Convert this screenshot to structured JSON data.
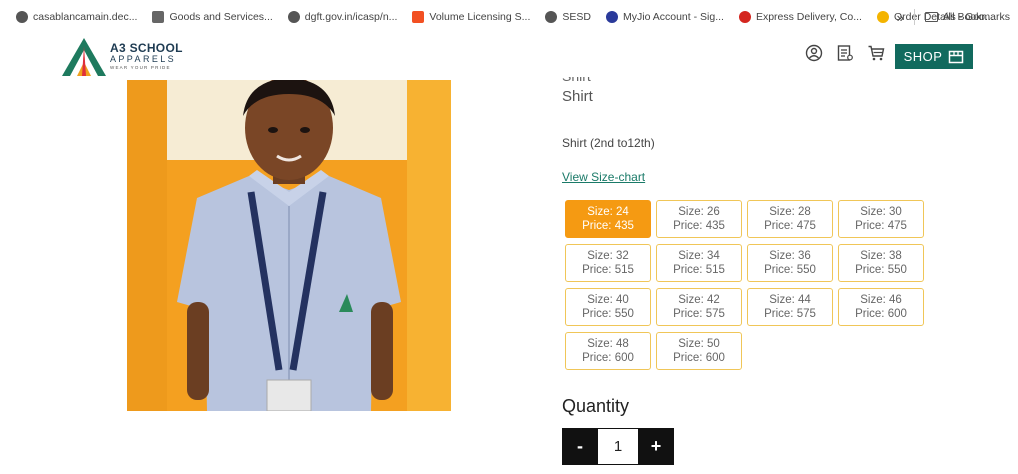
{
  "bookmarks": [
    {
      "label": "casablancamain.dec...",
      "icon": "globe-icon",
      "color": "#555555"
    },
    {
      "label": "Goods and Services...",
      "icon": "building-icon",
      "color": "#666666"
    },
    {
      "label": "dgft.gov.in/icasp/n...",
      "icon": "globe-icon",
      "color": "#555555"
    },
    {
      "label": "Volume Licensing S...",
      "icon": "microsoft-icon",
      "color": "#f25022"
    },
    {
      "label": "SESD",
      "icon": "globe-icon",
      "color": "#555555"
    },
    {
      "label": "MyJio Account - Sig...",
      "icon": "jio-icon",
      "color": "#2a3a9a"
    },
    {
      "label": "Express Delivery, Co...",
      "icon": "delivery-icon",
      "color": "#d4261f"
    },
    {
      "label": "Order Details - Goo...",
      "icon": "google-drive-icon",
      "color": "#f4b400"
    }
  ],
  "bookmarks_more": "»",
  "all_bookmarks": "All Bookmarks",
  "logo": {
    "title": "A3 SCHOOL",
    "subtitle": "APPARELS",
    "tagline": "WEAR YOUR PRIDE"
  },
  "header_icons": [
    "account-icon",
    "orders-icon",
    "cart-icon"
  ],
  "shop_button": "SHOP",
  "product": {
    "name_above": "Shirt",
    "name": "Shirt",
    "description": "Shirt (2nd to12th)",
    "size_chart_link": "View Size-chart",
    "quantity_label": "Quantity",
    "quantity": "1",
    "decrement": "-",
    "increment": "+"
  },
  "sizes": [
    {
      "size": "Size: 24",
      "price": "Price: 435",
      "selected": true
    },
    {
      "size": "Size: 26",
      "price": "Price: 435",
      "selected": false
    },
    {
      "size": "Size: 28",
      "price": "Price: 475",
      "selected": false
    },
    {
      "size": "Size: 30",
      "price": "Price: 475",
      "selected": false
    },
    {
      "size": "Size: 32",
      "price": "Price: 515",
      "selected": false
    },
    {
      "size": "Size: 34",
      "price": "Price: 515",
      "selected": false
    },
    {
      "size": "Size: 36",
      "price": "Price: 550",
      "selected": false
    },
    {
      "size": "Size: 38",
      "price": "Price: 550",
      "selected": false
    },
    {
      "size": "Size: 40",
      "price": "Price: 550",
      "selected": false
    },
    {
      "size": "Size: 42",
      "price": "Price: 575",
      "selected": false
    },
    {
      "size": "Size: 44",
      "price": "Price: 575",
      "selected": false
    },
    {
      "size": "Size: 46",
      "price": "Price: 600",
      "selected": false
    },
    {
      "size": "Size: 48",
      "price": "Price: 600",
      "selected": false
    },
    {
      "size": "Size: 50",
      "price": "Price: 600",
      "selected": false
    }
  ],
  "colors": {
    "brand_green": "#126a5e",
    "selected_size": "#f59a12",
    "size_border": "#f0c658",
    "photo_wall": "#f4a020"
  }
}
